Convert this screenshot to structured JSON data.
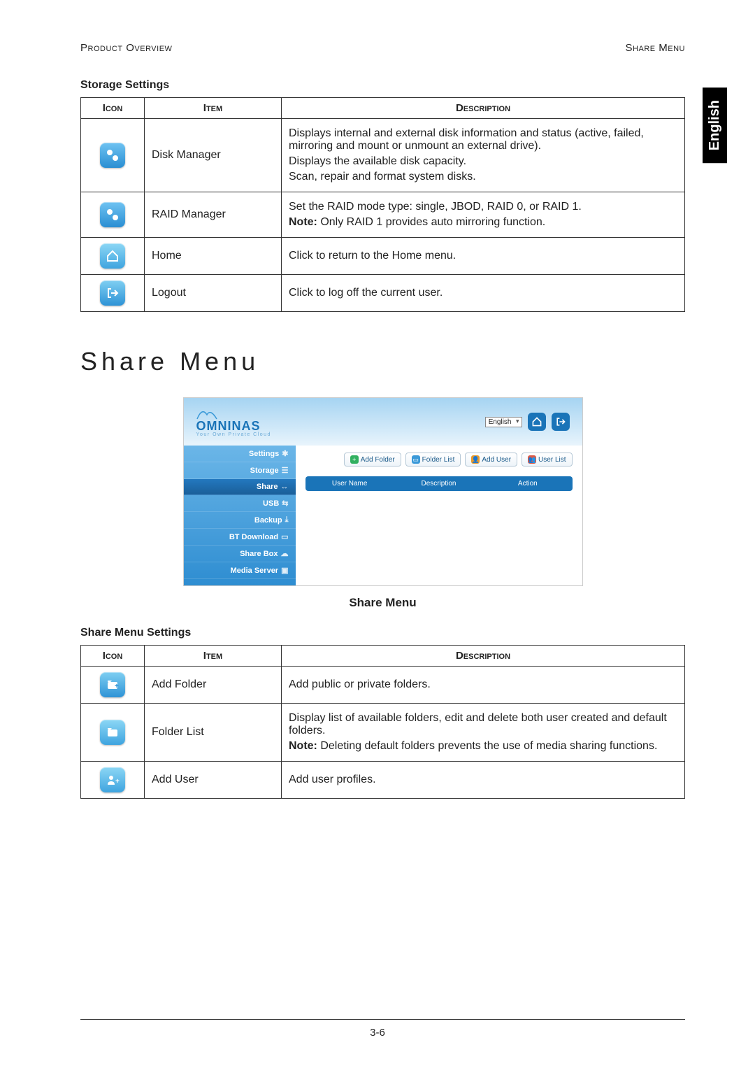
{
  "header": {
    "left": "Product Overview",
    "right": "Share Menu"
  },
  "lang_tab": "English",
  "storage": {
    "title": "Storage Settings",
    "cols": {
      "icon": "Icon",
      "item": "Item",
      "desc": "Description"
    },
    "rows": {
      "disk": {
        "item": "Disk Manager",
        "desc1": "Displays internal and external disk information and status (active, failed, mirroring and mount or unmount an external drive).",
        "desc2": "Displays the available disk capacity.",
        "desc3": "Scan, repair and format system disks."
      },
      "raid": {
        "item": "RAID Manager",
        "desc1": "Set the RAID mode type: single, JBOD, RAID 0, or RAID 1.",
        "note_prefix": "Note:",
        "note_rest": " Only RAID 1 provides auto mirroring function."
      },
      "home": {
        "item": "Home",
        "desc": "Click to return to the Home menu."
      },
      "logout": {
        "item": "Logout",
        "desc": "Click to log off the current user."
      }
    }
  },
  "heading": "Share Menu",
  "shot": {
    "brand": "OMNINAS",
    "tagline": "Your Own Private Cloud",
    "lang": "English",
    "menu": {
      "settings": "Settings",
      "storage": "Storage",
      "share": "Share",
      "usb": "USB",
      "backup": "Backup",
      "bt": "BT Download",
      "sharebox": "Share Box",
      "media": "Media Server"
    },
    "tabs": {
      "add_folder": "Add Folder",
      "folder_list": "Folder List",
      "add_user": "Add User",
      "user_list": "User List"
    },
    "grid": {
      "c1": "User Name",
      "c2": "Description",
      "c3": "Action"
    }
  },
  "fig_caption": "Share Menu",
  "share": {
    "title": "Share Menu Settings",
    "cols": {
      "icon": "Icon",
      "item": "Item",
      "desc": "Description"
    },
    "rows": {
      "add_folder": {
        "item": "Add Folder",
        "desc": "Add public or private folders."
      },
      "folder_list": {
        "item": "Folder List",
        "desc1": "Display list of available folders, edit and delete both user created and default folders.",
        "note_prefix": "Note:",
        "note_rest": " Deleting default folders prevents the use of media sharing functions."
      },
      "add_user": {
        "item": "Add User",
        "desc": "Add user profiles."
      }
    }
  },
  "page_number": "3-6"
}
